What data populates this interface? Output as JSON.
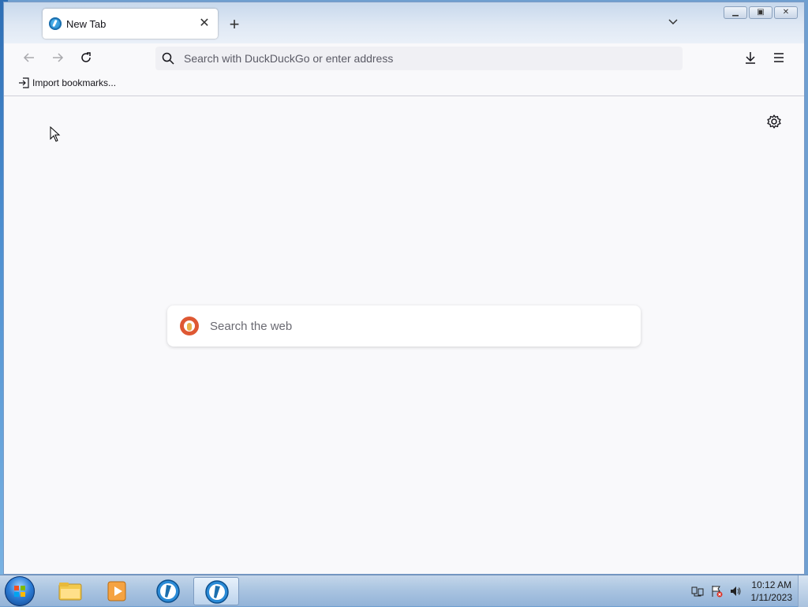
{
  "tabs": [
    {
      "title": "New Tab",
      "favicon": "duckduckgo-browser-icon",
      "active": true
    }
  ],
  "toolbar": {
    "back_icon": "arrow-left-icon",
    "forward_icon": "arrow-right-icon",
    "reload_icon": "reload-icon",
    "downloads_icon": "download-icon",
    "menu_icon": "hamburger-menu-icon"
  },
  "urlbar": {
    "placeholder": "Search with DuckDuckGo or enter address",
    "value": ""
  },
  "bookmarks": {
    "import_label": "Import bookmarks..."
  },
  "newtab": {
    "search_placeholder": "Search the web",
    "search_value": "",
    "settings_icon": "gear-icon"
  },
  "taskbar": {
    "items": [
      "windows-explorer",
      "media-player",
      "duckduckgo-browser",
      "duckduckgo-browser-active"
    ],
    "clock_time": "10:12 AM",
    "clock_date": "1/11/2023"
  },
  "colors": {
    "page_bg": "#f9f9fb",
    "urlbar_bg": "#f0f0f4",
    "ddg_orange": "#de5833"
  }
}
